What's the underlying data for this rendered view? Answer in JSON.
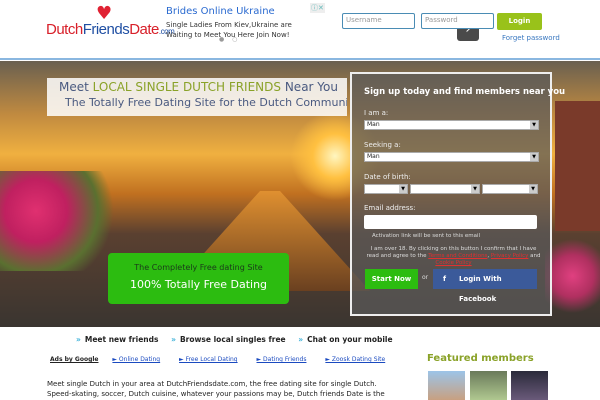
{
  "header": {
    "logo": {
      "part1": "Dutch",
      "part2": "Friends",
      "part3": "Date",
      "suffix": ".com"
    },
    "ad": {
      "title": "Brides Online Ukraine",
      "description": "Single Ladies From Kiev,Ukraine are Waiting to Meet You Here Join Now!",
      "arrow": "›",
      "info": "ⓘ✕",
      "dots": "● ○"
    },
    "username_placeholder": "Username",
    "password_placeholder": "Password",
    "login_label": "Login",
    "forgot_label": "Forget password"
  },
  "hero": {
    "tagline_pre": "Meet ",
    "tagline_highlight": "LOCAL SINGLE DUTCH FRIENDS",
    "tagline_post": " Near You",
    "tagline_sub": "The Totally Free Dating Site for the Dutch Community",
    "promo_small": "The Completely Free dating Site",
    "promo_big": "100% Totally Free Dating"
  },
  "form": {
    "title": "Sign up today and find members near you",
    "iam_label": "I am a:",
    "iam_value": "Man",
    "seeking_label": "Seeking a:",
    "seeking_value": "Man",
    "dob_label": "Date of birth:",
    "email_label": "Email address:",
    "activation_note": "Activation link will be sent to this email",
    "terms_pre": "I am over 18. By clicking on this button I confirm that I have read and agree to the ",
    "terms_link": "Terms and Conditions",
    "privacy_link": "Privacy Policy",
    "and": " and ",
    "cookie_link": "Cookie Policy",
    "start_label": "Start Now",
    "or": "or",
    "facebook_label": "Login With Facebook",
    "facebook_icon": "f"
  },
  "features": [
    "Meet new friends",
    "Browse local singles free",
    "Chat on your mobile"
  ],
  "ads": {
    "label": "Ads by Google",
    "links": [
      "► Online Dating",
      "► Free Local Dating",
      "► Dating Friends",
      "► Zoosk Dating Site"
    ]
  },
  "featured_title": "Featured members",
  "body_text": "Meet single Dutch in your area at DutchFriendsdate.com, the free dating site for single Dutch. Speed-skating, soccer, Dutch cuisine, whatever your passions may be, Dutch friends Date is the"
}
